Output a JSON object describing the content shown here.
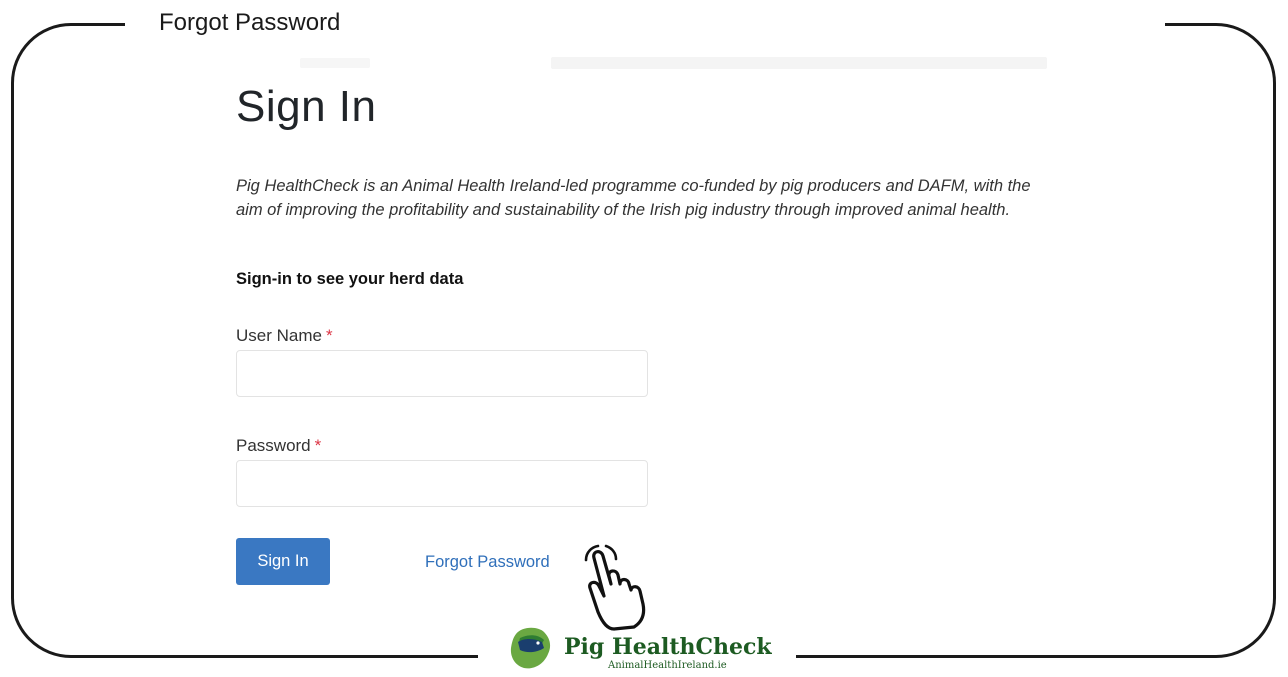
{
  "caption": "Forgot Password",
  "page": {
    "title": "Sign In",
    "intro": "Pig HealthCheck is an Animal Health Ireland-led programme co-funded by pig producers and DAFM, with the aim of improving the profitability and sustainability of the Irish pig industry through improved animal health.",
    "intro_strong": "Sign-in to see your herd data"
  },
  "form": {
    "username_label": "User Name",
    "username_required": "*",
    "username_value": "",
    "password_label": "Password",
    "password_required": "*",
    "password_value": "",
    "signin_button": "Sign In",
    "forgot_link": "Forgot Password"
  },
  "logo": {
    "name": "Pig HealthCheck",
    "url": "AnimalHealthIreland.ie"
  },
  "icons": {
    "pointer": "pointing-hand-icon",
    "emblem": "pig-ireland-emblem-icon"
  },
  "colors": {
    "primary_button": "#3a78c2",
    "link": "#2f6fba",
    "required": "#dc3545",
    "logo_green": "#1d5b22"
  }
}
